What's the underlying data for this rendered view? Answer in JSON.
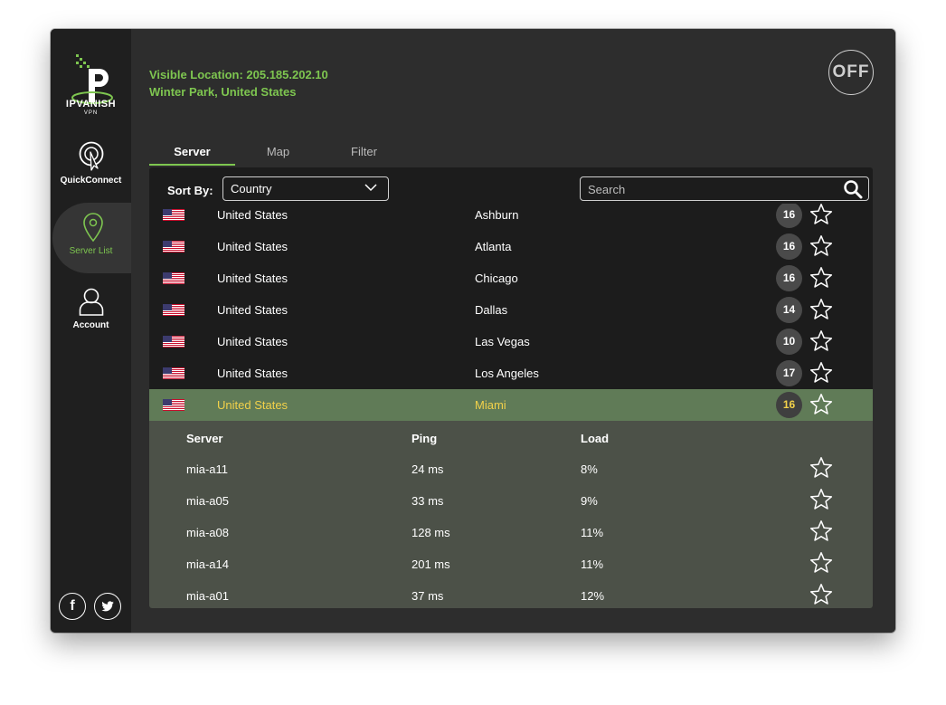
{
  "app": {
    "brand": "IPVANISH",
    "brand_sub": "VPN",
    "visible_location_line1": "Visible Location: 205.185.202.10",
    "visible_location_line2": "Winter Park, United States",
    "power_label": "OFF",
    "accent_color": "#7ec650",
    "highlight_text_color": "#f2d14a"
  },
  "sidebar": {
    "items": [
      {
        "label": "QuickConnect",
        "icon": "quickconnect-icon",
        "active": false
      },
      {
        "label": "Server List",
        "icon": "map-pin-icon",
        "active": true
      },
      {
        "label": "Account",
        "icon": "account-icon",
        "active": false
      }
    ],
    "social": [
      {
        "icon": "facebook-icon",
        "glyph": "f"
      },
      {
        "icon": "twitter-icon",
        "glyph": "t"
      }
    ]
  },
  "tabs": [
    {
      "label": "Server",
      "active": true
    },
    {
      "label": "Map",
      "active": false
    },
    {
      "label": "Filter",
      "active": false
    }
  ],
  "toolbar": {
    "sort_label": "Sort By:",
    "sort_value": "Country",
    "search_placeholder": "Search"
  },
  "servers": [
    {
      "country": "United States",
      "city": "Ashburn",
      "count": "16"
    },
    {
      "country": "United States",
      "city": "Atlanta",
      "count": "16"
    },
    {
      "country": "United States",
      "city": "Chicago",
      "count": "16"
    },
    {
      "country": "United States",
      "city": "Dallas",
      "count": "14"
    },
    {
      "country": "United States",
      "city": "Las Vegas",
      "count": "10"
    },
    {
      "country": "United States",
      "city": "Los Angeles",
      "count": "17"
    },
    {
      "country": "United States",
      "city": "Miami",
      "count": "16",
      "selected": true
    }
  ],
  "details": {
    "headers": {
      "server": "Server",
      "ping": "Ping",
      "load": "Load"
    },
    "rows": [
      {
        "server": "mia-a11",
        "ping": "24 ms",
        "load": "8%"
      },
      {
        "server": "mia-a05",
        "ping": "33 ms",
        "load": "9%"
      },
      {
        "server": "mia-a08",
        "ping": "128 ms",
        "load": "11%"
      },
      {
        "server": "mia-a14",
        "ping": "201 ms",
        "load": "11%"
      },
      {
        "server": "mia-a01",
        "ping": "37 ms",
        "load": "12%"
      }
    ]
  }
}
